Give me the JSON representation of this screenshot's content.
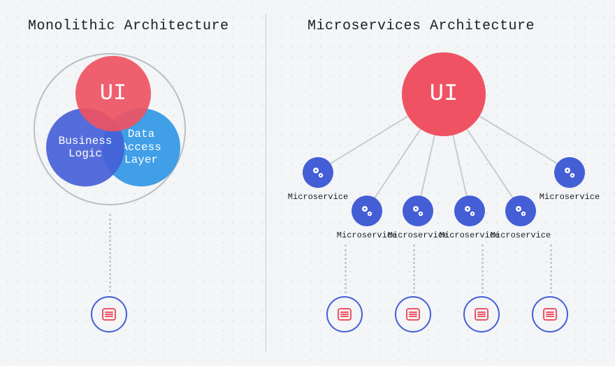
{
  "diagram": {
    "monolith": {
      "title": "Monolithic Architecture",
      "ui_label": "UI",
      "business_logic_label": "Business\nLogic",
      "data_access_label": "Data\nAccess\nLayer"
    },
    "microservices": {
      "title": "Microservices Architecture",
      "ui_label": "UI",
      "service_label": "Microservice",
      "service_count": 6,
      "db_count": 4
    },
    "colors": {
      "accent_red": "#ef5363",
      "accent_blue": "#445ed6",
      "accent_lightblue": "#2793e5",
      "line": "#c7ccd3"
    }
  }
}
